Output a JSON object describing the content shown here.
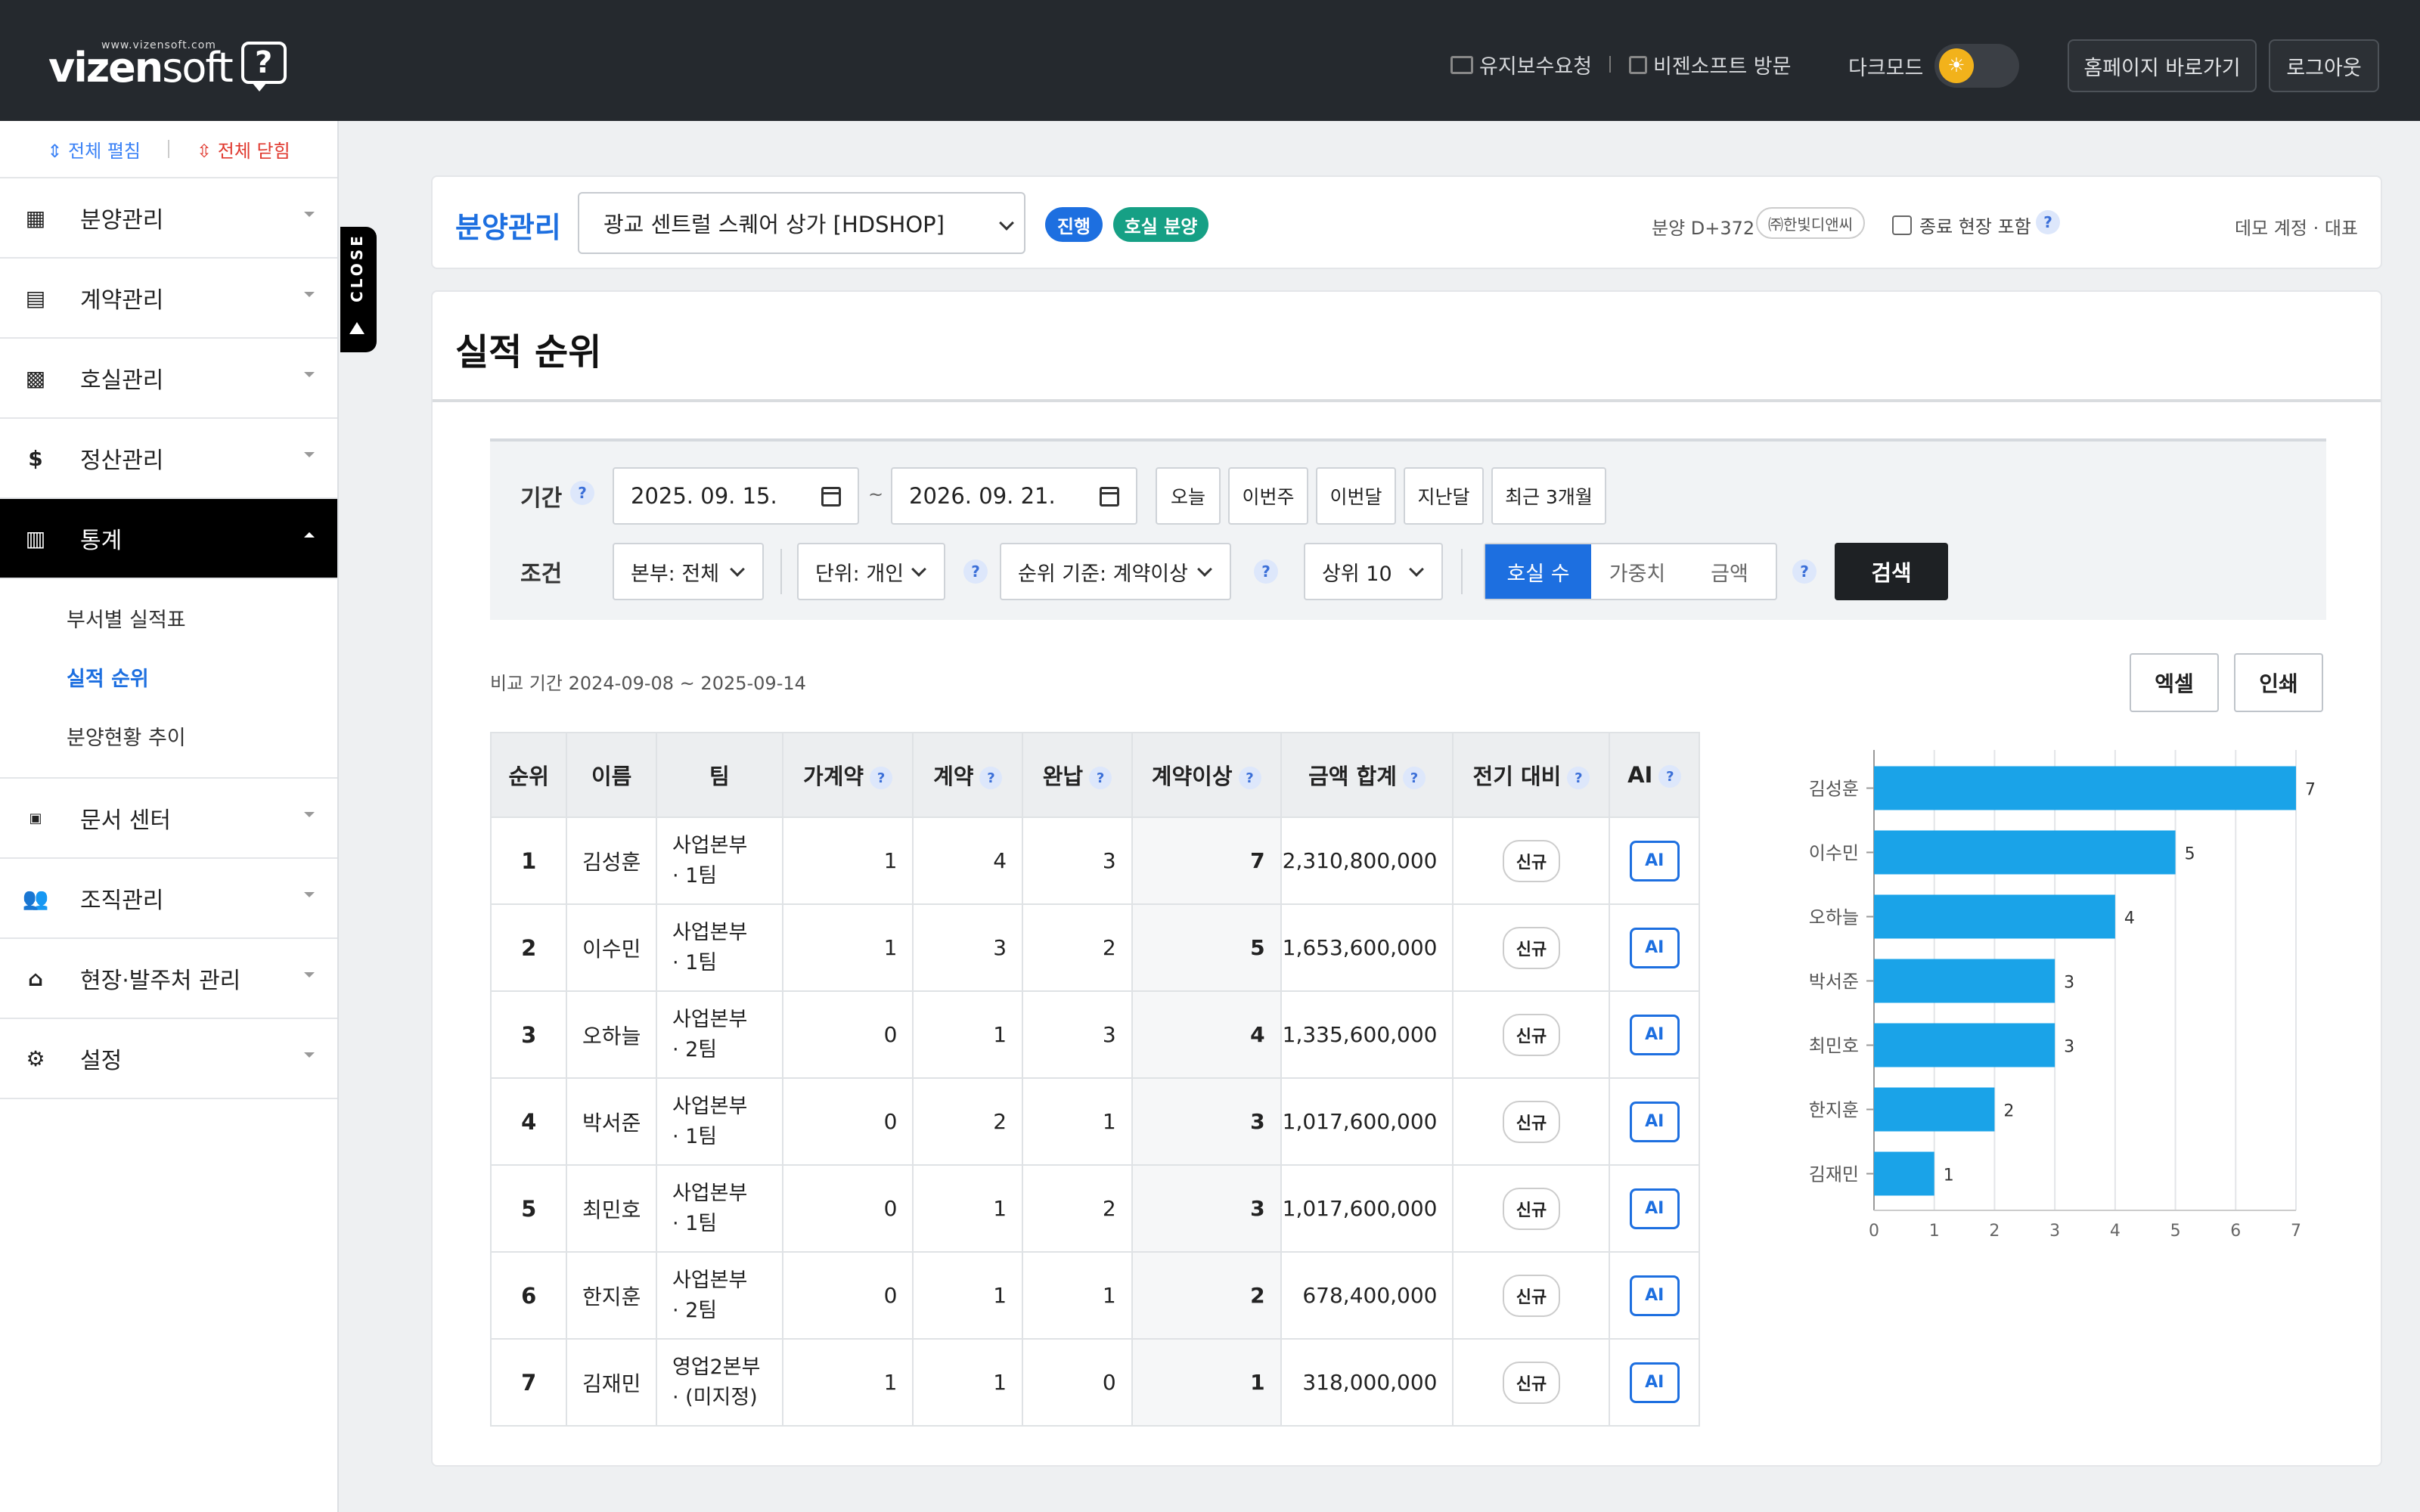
{
  "header": {
    "logo_url": "www.vizensoft.com",
    "logo_word_a": "vizen",
    "logo_word_b": "soft",
    "logo_q": "?",
    "maintenance": "유지보수요청",
    "visit": "비젠소프트 방문",
    "dark_mode": "다크모드",
    "homepage": "홈페이지 바로가기",
    "logout": "로그아웃"
  },
  "sidebar": {
    "expand_all": "전체 펼침",
    "collapse_all": "전체 닫힘",
    "close_tab": "CLOSE",
    "items": [
      {
        "label": "분양관리",
        "icon": "building-icon"
      },
      {
        "label": "계약관리",
        "icon": "document-icon"
      },
      {
        "label": "호실관리",
        "icon": "grid-icon"
      },
      {
        "label": "정산관리",
        "icon": "dollar-icon"
      },
      {
        "label": "통계",
        "icon": "bar-chart-icon"
      },
      {
        "label": "문서 센터",
        "icon": "pdf-icon"
      },
      {
        "label": "조직관리",
        "icon": "people-icon"
      },
      {
        "label": "현장·발주처 관리",
        "icon": "bank-icon"
      },
      {
        "label": "설정",
        "icon": "gear-icon"
      }
    ],
    "sub_items": [
      "부서별 실적표",
      "실적 순위",
      "분양현황 추이"
    ]
  },
  "context": {
    "title": "분양관리",
    "site": "광교 센트럴 스퀘어 상가 [HDSHOP]",
    "status_progress": "진행",
    "status_unit": "호실 분양",
    "days": "분양 D+372",
    "company": "㈜한빛디앤씨",
    "include_closed": "종료 현장 포함",
    "account": "데모 계정 · 대표",
    "colors": {
      "progress": "#1d6fe0",
      "unit": "#16a085"
    }
  },
  "page": {
    "title": "실적 순위"
  },
  "filter": {
    "period_label": "기간",
    "date_from": "2025. 09. 15.",
    "date_to": "2026. 09. 21.",
    "tilde": "~",
    "quick": [
      "오늘",
      "이번주",
      "이번달",
      "지난달",
      "최근 3개월"
    ],
    "cond_label": "조건",
    "division": "본부: 전체",
    "unit": "단위: 개인",
    "rank_basis": "순위 기준: 계약이상",
    "top_n": "상위 10",
    "metrics": [
      "호실 수",
      "가중치",
      "금액"
    ],
    "search": "검색"
  },
  "compare_period": "비교 기간 2024-09-08 ~ 2025-09-14",
  "actions": {
    "excel": "엑셀",
    "print": "인쇄"
  },
  "table": {
    "headers": [
      "순위",
      "이름",
      "팀",
      "가계약",
      "계약",
      "완납",
      "계약이상",
      "금액 합계",
      "전기 대비",
      "AI"
    ],
    "rows": [
      {
        "rank": "1",
        "name": "김성훈",
        "team1": "사업본부",
        "team2": "· 1팀",
        "pre": "1",
        "contract": "4",
        "paid": "3",
        "over": "7",
        "amount": "2,310,800,000",
        "vs": "신규",
        "ai": "AI"
      },
      {
        "rank": "2",
        "name": "이수민",
        "team1": "사업본부",
        "team2": "· 1팀",
        "pre": "1",
        "contract": "3",
        "paid": "2",
        "over": "5",
        "amount": "1,653,600,000",
        "vs": "신규",
        "ai": "AI"
      },
      {
        "rank": "3",
        "name": "오하늘",
        "team1": "사업본부",
        "team2": "· 2팀",
        "pre": "0",
        "contract": "1",
        "paid": "3",
        "over": "4",
        "amount": "1,335,600,000",
        "vs": "신규",
        "ai": "AI"
      },
      {
        "rank": "4",
        "name": "박서준",
        "team1": "사업본부",
        "team2": "· 1팀",
        "pre": "0",
        "contract": "2",
        "paid": "1",
        "over": "3",
        "amount": "1,017,600,000",
        "vs": "신규",
        "ai": "AI"
      },
      {
        "rank": "5",
        "name": "최민호",
        "team1": "사업본부",
        "team2": "· 1팀",
        "pre": "0",
        "contract": "1",
        "paid": "2",
        "over": "3",
        "amount": "1,017,600,000",
        "vs": "신규",
        "ai": "AI"
      },
      {
        "rank": "6",
        "name": "한지훈",
        "team1": "사업본부",
        "team2": "· 2팀",
        "pre": "0",
        "contract": "1",
        "paid": "1",
        "over": "2",
        "amount": "678,400,000",
        "vs": "신규",
        "ai": "AI"
      },
      {
        "rank": "7",
        "name": "김재민",
        "team1": "영업2본부",
        "team2": "· (미지정)",
        "pre": "1",
        "contract": "1",
        "paid": "0",
        "over": "1",
        "amount": "318,000,000",
        "vs": "신규",
        "ai": "AI"
      }
    ]
  },
  "chart_data": {
    "type": "bar",
    "orientation": "horizontal",
    "categories": [
      "김성훈",
      "이수민",
      "오하늘",
      "박서준",
      "최민호",
      "한지훈",
      "김재민"
    ],
    "values": [
      7,
      5,
      4,
      3,
      3,
      2,
      1
    ],
    "xlim": [
      0,
      7
    ],
    "xticks": [
      0,
      1,
      2,
      3,
      4,
      5,
      6,
      7
    ],
    "color": "#1aa3e8",
    "grid": true
  }
}
